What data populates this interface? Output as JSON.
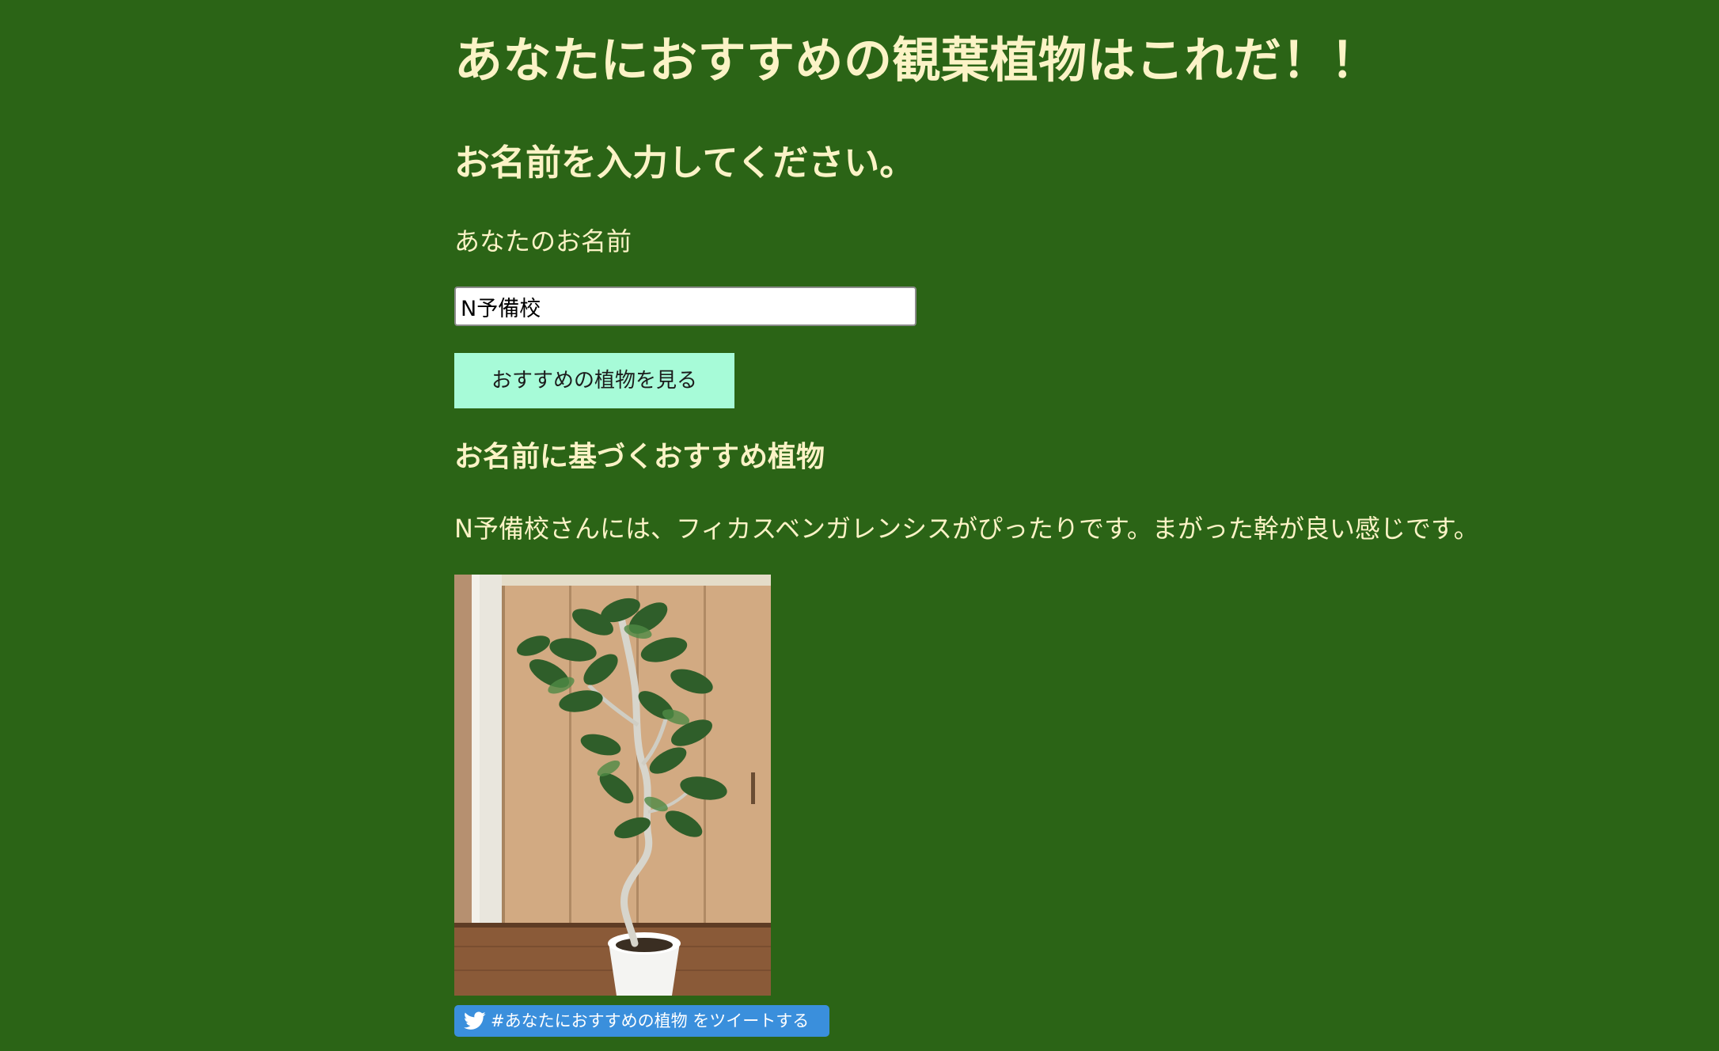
{
  "page": {
    "title": "あなたにおすすめの観葉植物はこれだ！！",
    "section_title": "お名前を入力してください。"
  },
  "form": {
    "name_label": "あなたのお名前",
    "name_value": "N予備校",
    "submit_label": "おすすめの植物を見る"
  },
  "result": {
    "title": "お名前に基づくおすすめ植物",
    "text": "N予備校さんには、フィカスベンガレンシスがぴったりです。まがった幹が良い感じです。",
    "image_subject": "ficus-benghalensis-potted-plant"
  },
  "share": {
    "tweet_label": "#あなたにおすすめの植物 をツイートする",
    "icon": "twitter-bird-icon"
  },
  "colors": {
    "background": "#2b6416",
    "text": "#fbf3c6",
    "button": "#a7fbd8",
    "tweet": "#3a8fdc"
  }
}
